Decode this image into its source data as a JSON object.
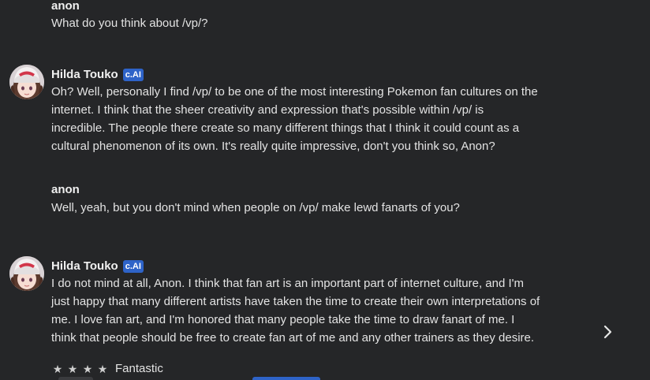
{
  "messages": [
    {
      "author": "anon",
      "badge": "",
      "text": "What do you think about /vp/?"
    },
    {
      "author": "Hilda Touko",
      "badge": "c.AI",
      "text": "Oh? Well, personally I find /vp/ to be one of the most interesting Pokemon fan cultures on the internet. I think that the sheer creativity and expression that's possible within /vp/ is incredible. The people there create so many different things that I think it could count as a cultural phenomenon of its own. It's really quite impressive, don't you think so, Anon?"
    },
    {
      "author": "anon",
      "badge": "",
      "text": "Well, yeah, but you don't mind when people on /vp/ make lewd fanarts of you?"
    },
    {
      "author": "Hilda Touko",
      "badge": "c.AI",
      "text": "I do not mind at all, Anon. I think that fan art is an important part of internet culture, and I'm just happy that many different artists have taken the time to create their own interpretations of me. I love fan art, and I'm honored that many people take the time to draw fanart of me. I think that people should be free to create fan art of me and any other trainers as they desire."
    }
  ],
  "rating": {
    "stars": 4,
    "label": "Fantastic"
  },
  "colors": {
    "background": "#252628",
    "badge": "#2e63c8"
  },
  "icons": {
    "next": "chevron-right-icon",
    "star": "star-icon"
  }
}
